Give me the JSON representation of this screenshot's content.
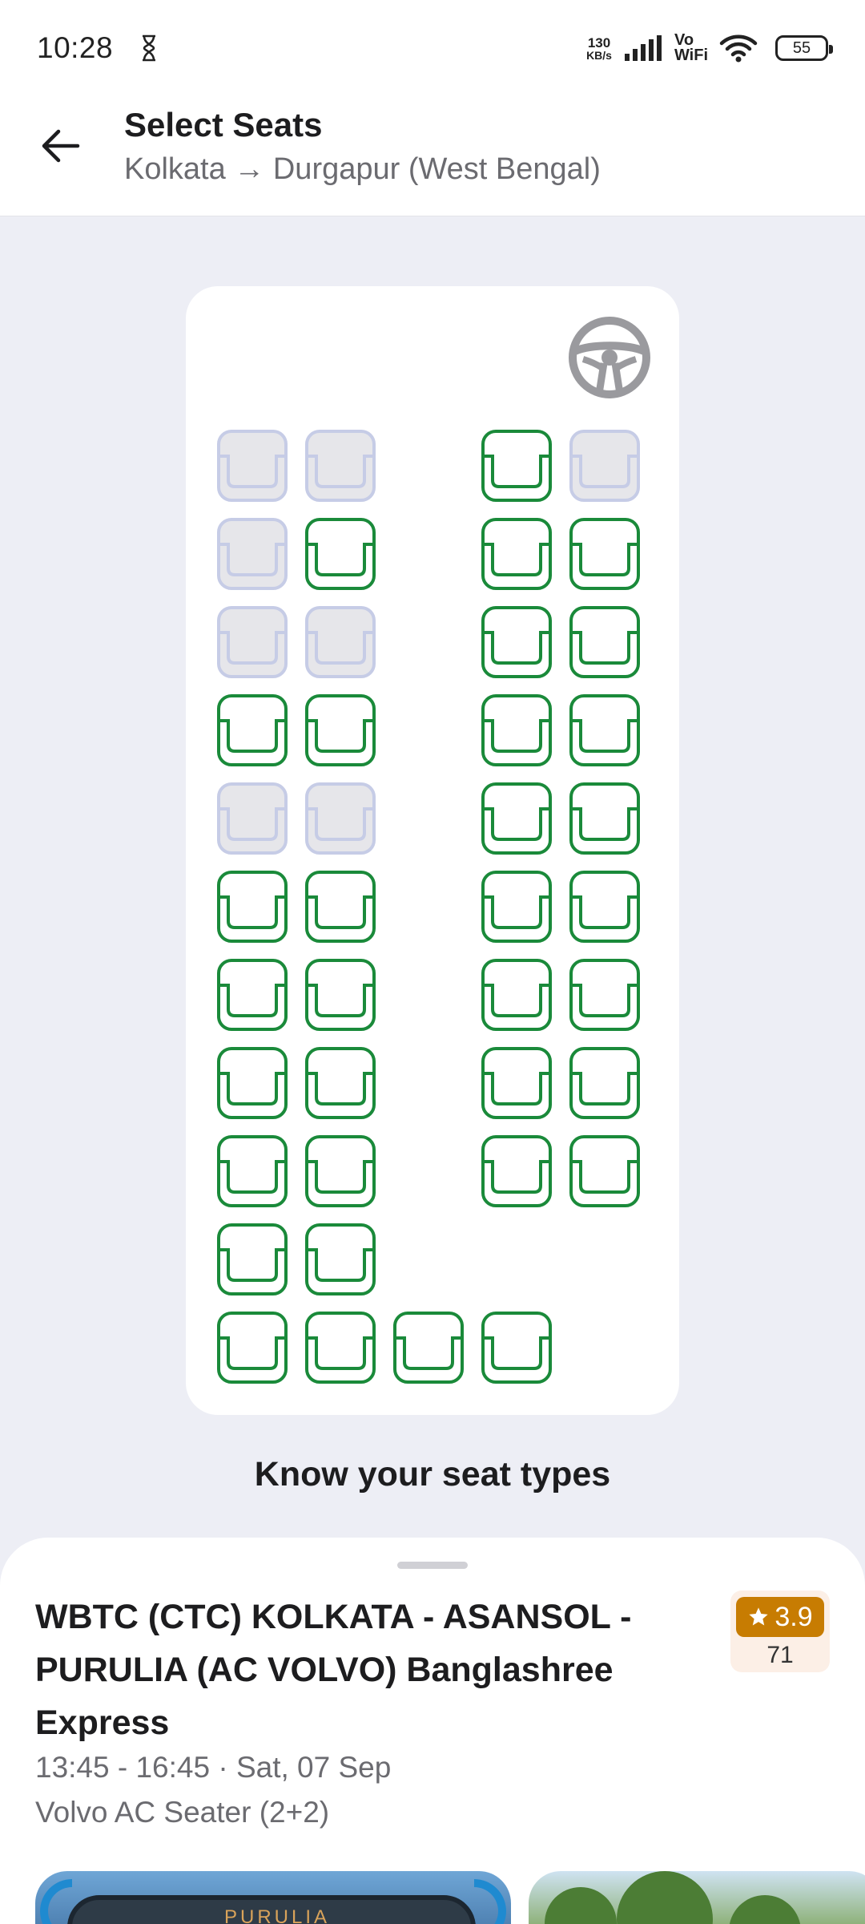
{
  "status_bar": {
    "time": "10:28",
    "net_speed_value": "130",
    "net_speed_unit": "KB/s",
    "vowifi_line1": "Vo",
    "vowifi_line2": "WiFi",
    "battery": "55"
  },
  "header": {
    "title": "Select Seats",
    "subtitle": "Kolkata → Durgapur (West Bengal)"
  },
  "seat_map": {
    "status_colors": {
      "available": "#1A8A3A",
      "booked_fill": "#E6E6EA",
      "booked_border": "#C6CCE6"
    },
    "icons": {
      "driver": "steering-wheel-icon",
      "seat": "seat-icon"
    },
    "rows": [
      [
        "booked",
        "booked",
        null,
        "available",
        "booked"
      ],
      [
        "booked",
        "available",
        null,
        "available",
        "available"
      ],
      [
        "booked",
        "booked",
        null,
        "available",
        "available"
      ],
      [
        "available",
        "available",
        null,
        "available",
        "available"
      ],
      [
        "booked",
        "booked",
        null,
        "available",
        "available"
      ],
      [
        "available",
        "available",
        null,
        "available",
        "available"
      ],
      [
        "available",
        "available",
        null,
        "available",
        "available"
      ],
      [
        "available",
        "available",
        null,
        "available",
        "available"
      ],
      [
        "available",
        "available",
        null,
        "available",
        "available"
      ],
      [
        "available",
        "available",
        null,
        null,
        null
      ],
      [
        "available",
        "available",
        "available",
        "available",
        null
      ]
    ]
  },
  "seat_types": {
    "title": "Know your seat types"
  },
  "bus": {
    "name": "WBTC (CTC) KOLKATA - ASANSOL - PURULIA (AC VOLVO) Banglashree Express",
    "timing": "13:45 - 16:45 · Sat, 07 Sep",
    "type": "Volvo AC Seater (2+2)",
    "rating": "3.9",
    "rating_count": "71",
    "rating_color": "#C77C02",
    "photo_text": "PURULIA"
  }
}
